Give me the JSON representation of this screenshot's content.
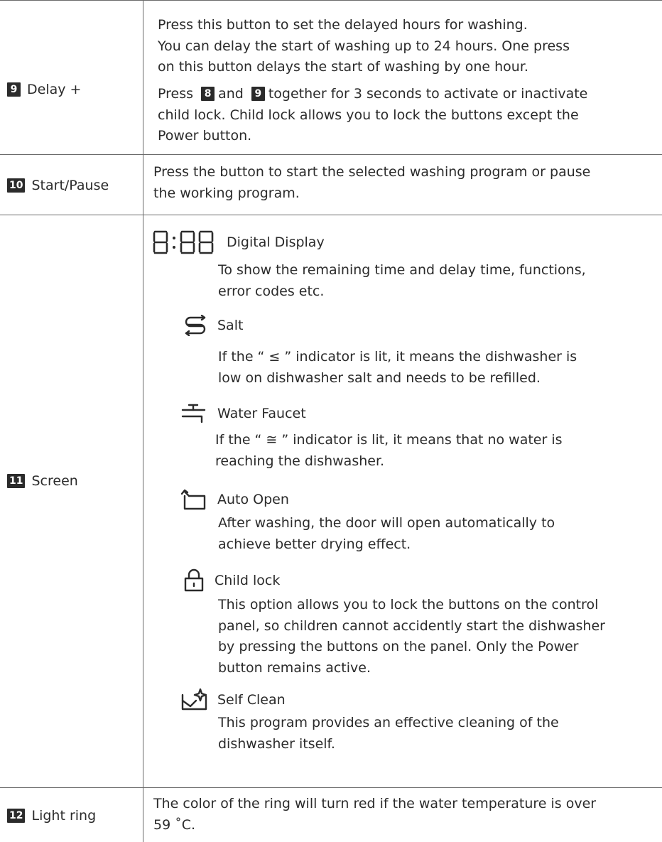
{
  "rows": [
    {
      "num": "9",
      "label": "Delay +",
      "p1": [
        "Press this button to set the delayed hours for washing.",
        "You can delay the start of washing up to 24 hours. One press",
        "on this button delays the start of washing by one hour."
      ],
      "p2_a": "Press",
      "p2_n1": "8",
      "p2_b": "and",
      "p2_n2": "9",
      "p2_c": "together for 3 seconds to activate or inactivate",
      "p2_rest": [
        "child lock. Child lock allows you to lock the buttons except the",
        "Power button."
      ]
    },
    {
      "num": "10",
      "label": "Start/Pause",
      "lines": [
        "Press the button to start the selected washing program or pause",
        "the working program."
      ]
    },
    {
      "num": "11",
      "label": "Screen",
      "items": [
        {
          "icon": "digital-display-icon",
          "title": "Digital Display",
          "lines": [
            "To show the remaining time and delay time, functions,",
            "error codes etc."
          ]
        },
        {
          "icon": "salt-icon",
          "title": "Salt",
          "lines": [
            "If the “ ≤ ” indicator is lit, it means the dishwasher is",
            "low on dishwasher salt and needs to be refilled."
          ]
        },
        {
          "icon": "water-faucet-icon",
          "title": "Water Faucet",
          "lines": [
            "If the “ ≅ ” indicator is lit,  it means that no water is",
            "reaching the dishwasher."
          ]
        },
        {
          "icon": "auto-open-icon",
          "title": "Auto Open",
          "lines": [
            "After washing, the door will open automatically to",
            "achieve better drying effect."
          ]
        },
        {
          "icon": "child-lock-icon",
          "title": "Child lock",
          "lines": [
            "This option allows you to lock the buttons on the control",
            "panel, so children cannot accidently start the dishwasher",
            "by pressing the buttons on the panel. Only the Power",
            "button remains active."
          ]
        },
        {
          "icon": "self-clean-icon",
          "title": "Self Clean",
          "lines": [
            "This program provides an effective cleaning of the",
            "dishwasher itself."
          ]
        }
      ]
    },
    {
      "num": "12",
      "label": "Light ring",
      "lines": [
        "The  color of the ring will turn red if the water temperature is over",
        "59 ˚C."
      ]
    }
  ]
}
